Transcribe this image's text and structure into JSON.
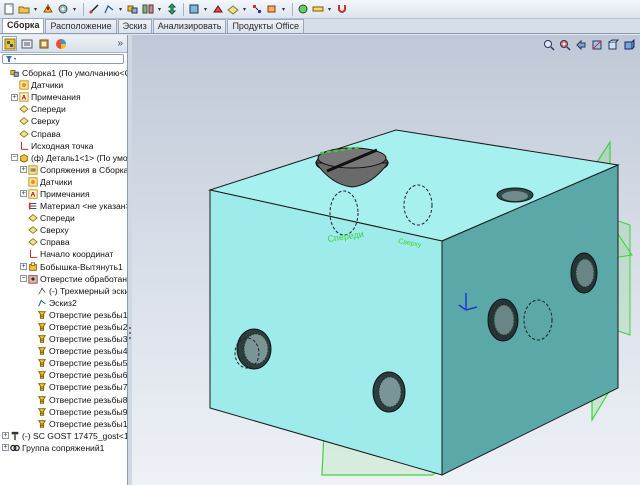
{
  "toolbar": {
    "icons": [
      "new-doc-icon",
      "open-icon",
      "rebuild-icon",
      "options-icon",
      "smart-dimension-icon",
      "sketch-icon",
      "assembly-icon",
      "mate-icon",
      "move-component-icon",
      "show-hidden-icon",
      "features-icon",
      "reference-geometry-icon",
      "explode-icon",
      "instant3d-icon",
      "snap-icon",
      "measure-icon",
      "magnet-icon"
    ]
  },
  "tabs": [
    "Сборка",
    "Расположение",
    "Эскиз",
    "Анализировать",
    "Продукты Office"
  ],
  "active_tab": "Сборка",
  "panel_tabs": [
    "feature-manager-icon",
    "property-manager-icon",
    "configuration-manager-icon",
    "display-manager-icon"
  ],
  "panel_expand": "»",
  "tree": [
    {
      "label": "Сборка1  (По умолчанию<Со",
      "icon": "assembly-icon",
      "level": 0,
      "exp": ""
    },
    {
      "label": "Датчики",
      "icon": "sensors-icon",
      "level": 1,
      "exp": ""
    },
    {
      "label": "Примечания",
      "icon": "annotations-icon",
      "level": 1,
      "exp": "+"
    },
    {
      "label": "Спереди",
      "icon": "plane-icon",
      "level": 1,
      "exp": ""
    },
    {
      "label": "Сверху",
      "icon": "plane-icon",
      "level": 1,
      "exp": ""
    },
    {
      "label": "Справа",
      "icon": "plane-icon",
      "level": 1,
      "exp": ""
    },
    {
      "label": "Исходная точка",
      "icon": "origin-icon",
      "level": 1,
      "exp": ""
    },
    {
      "label": "(ф) Деталь1<1> (По умолч",
      "icon": "part-icon",
      "level": 1,
      "exp": "−"
    },
    {
      "label": "Сопряжения в Сборка1",
      "icon": "mates-icon",
      "level": 2,
      "exp": "+"
    },
    {
      "label": "Датчики",
      "icon": "sensors-icon",
      "level": 2,
      "exp": ""
    },
    {
      "label": "Примечания",
      "icon": "annotations-icon",
      "level": 2,
      "exp": "+"
    },
    {
      "label": "Материал <не указан>",
      "icon": "material-icon",
      "level": 2,
      "exp": ""
    },
    {
      "label": "Спереди",
      "icon": "plane-icon",
      "level": 2,
      "exp": ""
    },
    {
      "label": "Сверху",
      "icon": "plane-icon",
      "level": 2,
      "exp": ""
    },
    {
      "label": "Справа",
      "icon": "plane-icon",
      "level": 2,
      "exp": ""
    },
    {
      "label": "Начало координат",
      "icon": "origin-icon",
      "level": 2,
      "exp": ""
    },
    {
      "label": "Бобышка-Вытянуть1",
      "icon": "extrude-icon",
      "level": 2,
      "exp": "+"
    },
    {
      "label": "Отверстие обработанно",
      "icon": "hole-wizard-icon",
      "level": 2,
      "exp": "−"
    },
    {
      "label": "(-) Трехмерный эскиз",
      "icon": "sketch3d-icon",
      "level": 3,
      "exp": ""
    },
    {
      "label": "Эскиз2",
      "icon": "sketch-icon",
      "level": 3,
      "exp": ""
    },
    {
      "label": "Отверстие резьбы1",
      "icon": "thread-hole-icon",
      "level": 3,
      "exp": ""
    },
    {
      "label": "Отверстие резьбы2",
      "icon": "thread-hole-icon",
      "level": 3,
      "exp": ""
    },
    {
      "label": "Отверстие резьбы3",
      "icon": "thread-hole-icon",
      "level": 3,
      "exp": ""
    },
    {
      "label": "Отверстие резьбы4",
      "icon": "thread-hole-icon",
      "level": 3,
      "exp": ""
    },
    {
      "label": "Отверстие резьбы5",
      "icon": "thread-hole-icon",
      "level": 3,
      "exp": ""
    },
    {
      "label": "Отверстие резьбы6",
      "icon": "thread-hole-icon",
      "level": 3,
      "exp": ""
    },
    {
      "label": "Отверстие резьбы7",
      "icon": "thread-hole-icon",
      "level": 3,
      "exp": ""
    },
    {
      "label": "Отверстие резьбы8",
      "icon": "thread-hole-icon",
      "level": 3,
      "exp": ""
    },
    {
      "label": "Отверстие резьбы9",
      "icon": "thread-hole-icon",
      "level": 3,
      "exp": ""
    },
    {
      "label": "Отверстие резьбы10",
      "icon": "thread-hole-icon",
      "level": 3,
      "exp": ""
    },
    {
      "label": "(-) SC GOST 17475_gost<1>",
      "icon": "screw-part-icon",
      "level": 0,
      "exp": "+"
    },
    {
      "label": "Группа сопряжений1",
      "icon": "mate-group-icon",
      "level": 0,
      "exp": "+"
    }
  ],
  "viewport": {
    "view_tools": [
      "zoom-to-fit-icon",
      "zoom-area-icon",
      "previous-view-icon",
      "section-view-icon",
      "view-orientation-icon",
      "display-style-icon"
    ],
    "plane_labels": {
      "front": "Спереди",
      "top": "Сверху"
    },
    "colors": {
      "part_face_top": "#a6f0ef",
      "part_face_front": "#9debea",
      "part_face_side": "#5aa8a7",
      "plane": "#3fd23a",
      "background_top": "#bfc8d6",
      "background_bottom": "#eef1f6"
    }
  }
}
